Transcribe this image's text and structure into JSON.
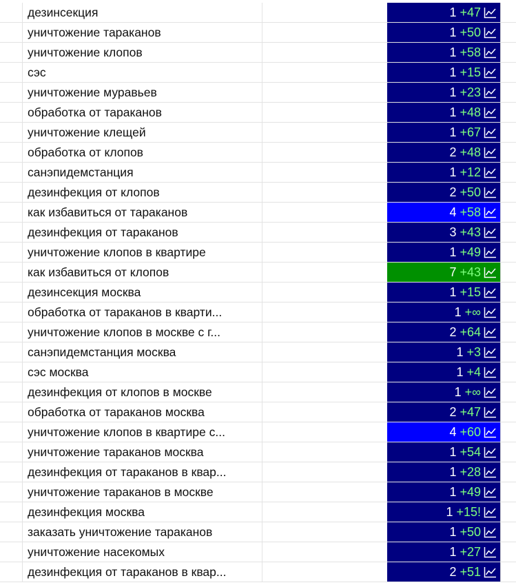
{
  "colors": {
    "default": "#000080",
    "highlight_blue": "#0000ff",
    "highlight_green": "#009000",
    "delta_text": "#7dff7d"
  },
  "rows": [
    {
      "keyword": "дезинсекция",
      "rank": "1",
      "delta": "+47",
      "color": "#000080"
    },
    {
      "keyword": "уничтожение тараканов",
      "rank": "1",
      "delta": "+50",
      "color": "#000080"
    },
    {
      "keyword": "уничтожение клопов",
      "rank": "1",
      "delta": "+58",
      "color": "#000080"
    },
    {
      "keyword": "сэс",
      "rank": "1",
      "delta": "+15",
      "color": "#000080"
    },
    {
      "keyword": "уничтожение муравьев",
      "rank": "1",
      "delta": "+23",
      "color": "#000080"
    },
    {
      "keyword": "обработка от тараканов",
      "rank": "1",
      "delta": "+48",
      "color": "#000080"
    },
    {
      "keyword": "уничтожение клещей",
      "rank": "1",
      "delta": "+67",
      "color": "#000080"
    },
    {
      "keyword": "обработка от клопов",
      "rank": "2",
      "delta": "+48",
      "color": "#000080"
    },
    {
      "keyword": "санэпидемстанция",
      "rank": "1",
      "delta": "+12",
      "color": "#000080"
    },
    {
      "keyword": "дезинфекция от клопов",
      "rank": "2",
      "delta": "+50",
      "color": "#000080"
    },
    {
      "keyword": "как избавиться от тараканов",
      "rank": "4",
      "delta": "+58",
      "color": "#0000ff"
    },
    {
      "keyword": "дезинфекция от тараканов",
      "rank": "3",
      "delta": "+43",
      "color": "#000080"
    },
    {
      "keyword": "уничтожение клопов в квартире",
      "rank": "1",
      "delta": "+49",
      "color": "#000080"
    },
    {
      "keyword": "как избавиться от клопов",
      "rank": "7",
      "delta": "+43",
      "color": "#009000"
    },
    {
      "keyword": "дезинсекция москва",
      "rank": "1",
      "delta": "+15",
      "color": "#000080"
    },
    {
      "keyword": "обработка от тараканов в кварти...",
      "rank": "1",
      "delta": "+∞",
      "color": "#000080"
    },
    {
      "keyword": "уничтожение клопов в москве с г...",
      "rank": "2",
      "delta": "+64",
      "color": "#000080"
    },
    {
      "keyword": "санэпидемстанция москва",
      "rank": "1",
      "delta": "+3",
      "color": "#000080"
    },
    {
      "keyword": "сэс москва",
      "rank": "1",
      "delta": "+4",
      "color": "#000080"
    },
    {
      "keyword": "дезинфекция от клопов в москве",
      "rank": "1",
      "delta": "+∞",
      "color": "#000080"
    },
    {
      "keyword": "обработка от тараканов москва",
      "rank": "2",
      "delta": "+47",
      "color": "#000080"
    },
    {
      "keyword": "уничтожение клопов в квартире с...",
      "rank": "4",
      "delta": "+60",
      "color": "#0000ff"
    },
    {
      "keyword": "уничтожение тараканов москва",
      "rank": "1",
      "delta": "+54",
      "color": "#000080"
    },
    {
      "keyword": "дезинфекция от тараканов в квар...",
      "rank": "1",
      "delta": "+28",
      "color": "#000080"
    },
    {
      "keyword": "уничтожение тараканов в москве",
      "rank": "1",
      "delta": "+49",
      "color": "#000080"
    },
    {
      "keyword": "дезинфекция москва",
      "rank": "1",
      "delta": "+15!",
      "color": "#000080"
    },
    {
      "keyword": "заказать уничтожение тараканов",
      "rank": "1",
      "delta": "+50",
      "color": "#000080"
    },
    {
      "keyword": "уничтожение насекомых",
      "rank": "1",
      "delta": "+27",
      "color": "#000080"
    },
    {
      "keyword": "дезинфекция от тараканов в квар...",
      "rank": "2",
      "delta": "+51",
      "color": "#000080"
    }
  ]
}
